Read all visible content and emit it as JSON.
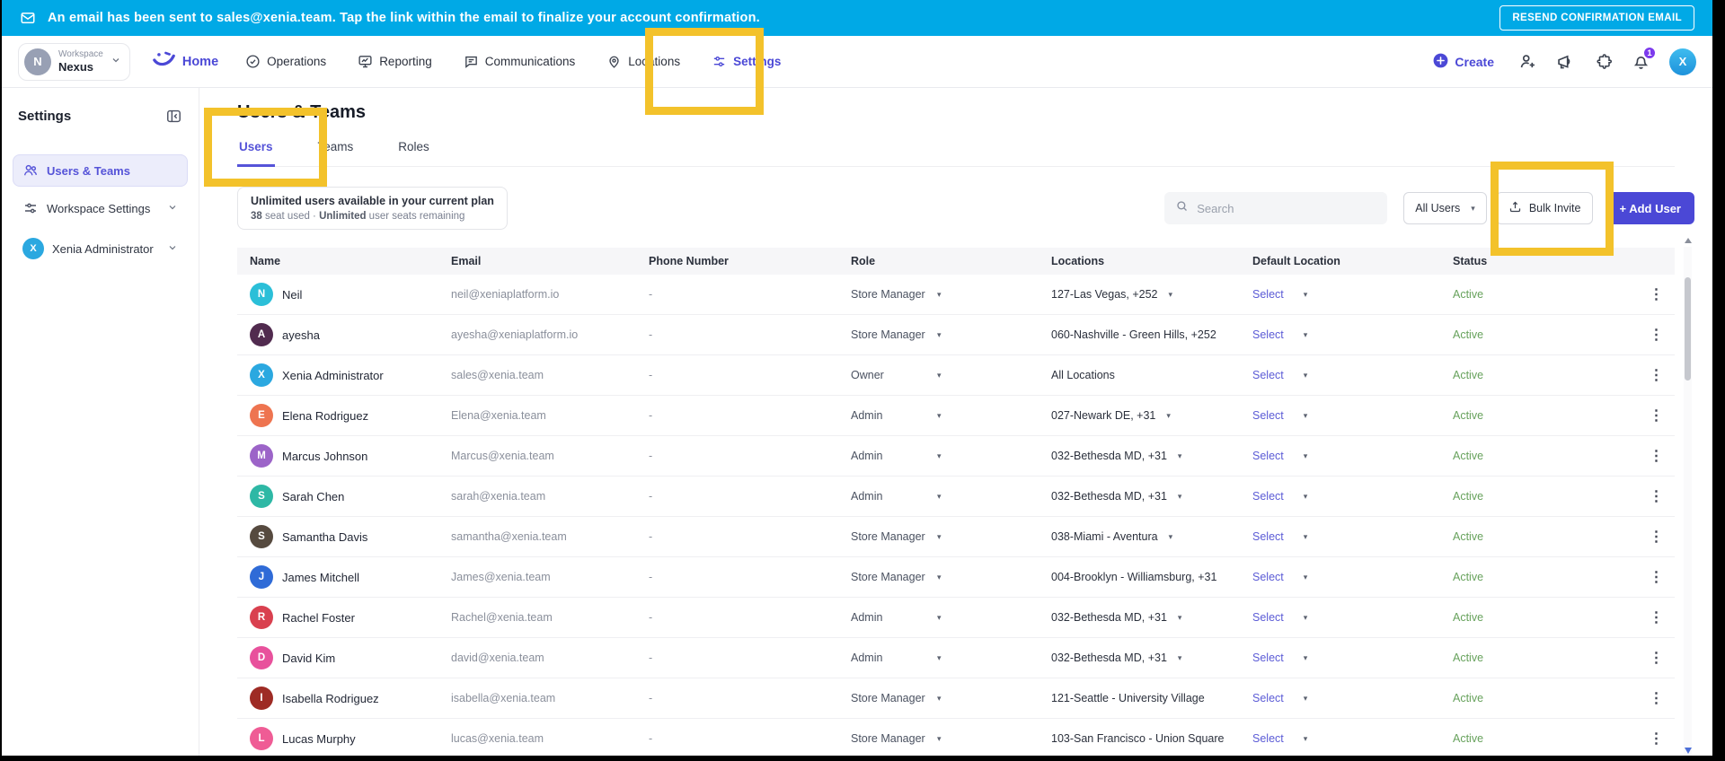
{
  "colors": {
    "banner_bg": "#00A9E6",
    "accent_purple": "#4B48D6",
    "highlight_yellow": "#F3C22B",
    "status_green": "#67A25C"
  },
  "banner": {
    "message": "An email has been sent to sales@xenia.team. Tap the link within the email to finalize your account confirmation.",
    "resend_button_label": "RESEND CONFIRMATION EMAIL"
  },
  "topnav": {
    "workspace_label": "Workspace",
    "workspace_name": "Nexus",
    "workspace_initial": "N",
    "home_label": "Home",
    "nav_items": [
      {
        "label": "Operations",
        "icon": "check-circle-icon",
        "active": false
      },
      {
        "label": "Reporting",
        "icon": "monitor-icon",
        "active": false
      },
      {
        "label": "Communications",
        "icon": "chat-icon",
        "active": false
      },
      {
        "label": "Locations",
        "icon": "pin-icon",
        "active": false
      },
      {
        "label": "Settings",
        "icon": "settings-icon",
        "active": true
      }
    ],
    "create_label": "Create",
    "notification_badge": "1",
    "profile_initial": "X"
  },
  "sidebar": {
    "title": "Settings",
    "items": [
      {
        "label": "Users & Teams"
      },
      {
        "label": "Workspace Settings"
      },
      {
        "label": "Xenia Administrator",
        "initial": "X"
      }
    ]
  },
  "main": {
    "page_title": "Users & Teams",
    "tabs": [
      {
        "label": "Users",
        "active": true
      },
      {
        "label": "Teams",
        "active": false
      },
      {
        "label": "Roles",
        "active": false
      }
    ],
    "plan_box": {
      "line1": "Unlimited users available in your current plan",
      "seats_used": "38",
      "line2_mid": " seat used · ",
      "seats_remaining": "Unlimited",
      "line2_suffix": " user seats remaining"
    },
    "controls": {
      "search_placeholder": "Search",
      "filter_value": "All Users",
      "bulk_invite_label": "Bulk Invite",
      "add_user_label": "+ Add User"
    },
    "table": {
      "columns": [
        "Name",
        "Email",
        "Phone Number",
        "Role",
        "Locations",
        "Default Location",
        "Status"
      ],
      "rows": [
        {
          "name": "Neil",
          "initial": "N",
          "avatar_color": "#2BBFD8",
          "email": "neil@xeniaplatform.io",
          "phone": "-",
          "role": "Store Manager",
          "locations": "127-Las Vegas, +252",
          "locations_caret": true,
          "default_location": "Select",
          "status": "Active"
        },
        {
          "name": "ayesha",
          "initial": "A",
          "avatar_color": "#512B4F",
          "email": "ayesha@xeniaplatform.io",
          "phone": "-",
          "role": "Store Manager",
          "locations": "060-Nashville - Green Hills, +252",
          "locations_caret": false,
          "default_location": "Select",
          "status": "Active"
        },
        {
          "name": "Xenia Administrator",
          "initial": "X",
          "avatar_color": "#2BA8E0",
          "email": "sales@xenia.team",
          "phone": "-",
          "role": "Owner",
          "locations": "All Locations",
          "locations_caret": false,
          "default_location": "Select",
          "status": "Active"
        },
        {
          "name": "Elena Rodriguez",
          "initial": "E",
          "avatar_color": "#EE7450",
          "email": "Elena@xenia.team",
          "phone": "-",
          "role": "Admin",
          "locations": "027-Newark DE, +31",
          "locations_caret": true,
          "default_location": "Select",
          "status": "Active"
        },
        {
          "name": "Marcus Johnson",
          "initial": "M",
          "avatar_color": "#9C64C8",
          "email": "Marcus@xenia.team",
          "phone": "-",
          "role": "Admin",
          "locations": "032-Bethesda MD, +31",
          "locations_caret": true,
          "default_location": "Select",
          "status": "Active"
        },
        {
          "name": "Sarah Chen",
          "initial": "S",
          "avatar_color": "#2EB8A5",
          "email": "sarah@xenia.team",
          "phone": "-",
          "role": "Admin",
          "locations": "032-Bethesda MD, +31",
          "locations_caret": true,
          "default_location": "Select",
          "status": "Active"
        },
        {
          "name": "Samantha Davis",
          "initial": "S",
          "avatar_color": "#564A3F",
          "email": "samantha@xenia.team",
          "phone": "-",
          "role": "Store Manager",
          "locations": "038-Miami - Aventura",
          "locations_caret": true,
          "default_location": "Select",
          "status": "Active"
        },
        {
          "name": "James Mitchell",
          "initial": "J",
          "avatar_color": "#2F6BD7",
          "email": "James@xenia.team",
          "phone": "-",
          "role": "Store Manager",
          "locations": "004-Brooklyn - Williamsburg, +31",
          "locations_caret": false,
          "default_location": "Select",
          "status": "Active"
        },
        {
          "name": "Rachel Foster",
          "initial": "R",
          "avatar_color": "#D9404F",
          "email": "Rachel@xenia.team",
          "phone": "-",
          "role": "Admin",
          "locations": "032-Bethesda MD, +31",
          "locations_caret": true,
          "default_location": "Select",
          "status": "Active"
        },
        {
          "name": "David Kim",
          "initial": "D",
          "avatar_color": "#E8519C",
          "email": "david@xenia.team",
          "phone": "-",
          "role": "Admin",
          "locations": "032-Bethesda MD, +31",
          "locations_caret": true,
          "default_location": "Select",
          "status": "Active"
        },
        {
          "name": "Isabella Rodriguez",
          "initial": "I",
          "avatar_color": "#9E2B25",
          "email": "isabella@xenia.team",
          "phone": "-",
          "role": "Store Manager",
          "locations": "121-Seattle - University Village",
          "locations_caret": false,
          "default_location": "Select",
          "status": "Active"
        },
        {
          "name": "Lucas Murphy",
          "initial": "L",
          "avatar_color": "#EF5C95",
          "email": "lucas@xenia.team",
          "phone": "-",
          "role": "Store Manager",
          "locations": "103-San Francisco - Union Square",
          "locations_caret": false,
          "default_location": "Select",
          "status": "Active"
        }
      ]
    }
  }
}
